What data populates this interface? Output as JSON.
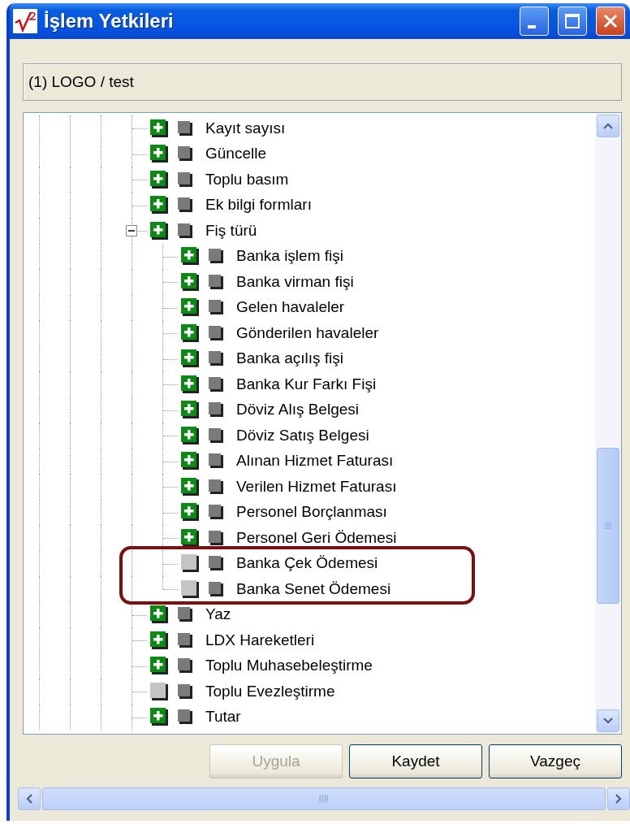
{
  "window": {
    "title": "İşlem Yetkileri"
  },
  "header": {
    "text": "(1) LOGO / test"
  },
  "tree": [
    {
      "label": "Kayıt sayısı",
      "granted": true
    },
    {
      "label": "Güncelle",
      "granted": true
    },
    {
      "label": "Toplu basım",
      "granted": true
    },
    {
      "label": "Ek bilgi formları",
      "granted": true
    },
    {
      "label": "Fiş türü",
      "granted": true,
      "expanded": true,
      "children": [
        {
          "label": "Banka işlem fişi",
          "granted": true,
          "highlighted": false
        },
        {
          "label": "Banka virman fişi",
          "granted": true,
          "highlighted": false
        },
        {
          "label": "Gelen havaleler",
          "granted": true,
          "highlighted": false
        },
        {
          "label": "Gönderilen havaleler",
          "granted": true,
          "highlighted": false
        },
        {
          "label": "Banka açılış fişi",
          "granted": true,
          "highlighted": false
        },
        {
          "label": "Banka Kur Farkı Fişi",
          "granted": true,
          "highlighted": false
        },
        {
          "label": "Döviz Alış Belgesi",
          "granted": true,
          "highlighted": false
        },
        {
          "label": "Döviz Satış Belgesi",
          "granted": true,
          "highlighted": false
        },
        {
          "label": "Alınan Hizmet Faturası",
          "granted": true,
          "highlighted": false
        },
        {
          "label": "Verilen Hizmet Faturası",
          "granted": true,
          "highlighted": false
        },
        {
          "label": "Personel Borçlanması",
          "granted": true,
          "highlighted": false
        },
        {
          "label": "Personel Geri Ödemesi",
          "granted": true,
          "highlighted": false
        },
        {
          "label": "Banka Çek Ödemesi",
          "granted": false,
          "highlighted": true
        },
        {
          "label": "Banka Senet Ödemesi",
          "granted": false,
          "highlighted": true
        }
      ]
    },
    {
      "label": "Yaz",
      "granted": true
    },
    {
      "label": "LDX Hareketleri",
      "granted": true
    },
    {
      "label": "Toplu Muhasebeleştirme",
      "granted": true
    },
    {
      "label": "Toplu Evezleştirme",
      "granted": false
    },
    {
      "label": "Tutar",
      "granted": true
    }
  ],
  "buttons": [
    {
      "label": "Uygula",
      "disabled": true
    },
    {
      "label": "Kaydet",
      "disabled": false
    },
    {
      "label": "Vazgeç",
      "disabled": false
    }
  ]
}
